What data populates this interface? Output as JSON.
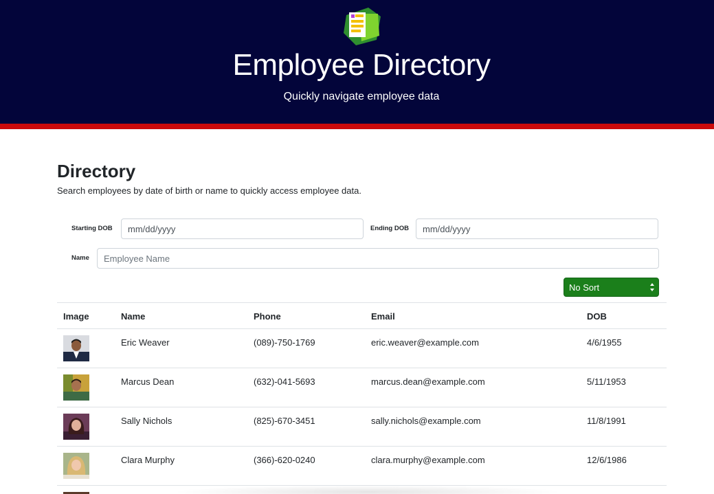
{
  "header": {
    "title": "Employee Directory",
    "subtitle": "Quickly navigate employee data",
    "logo_icon": "document-folder-icon"
  },
  "directory": {
    "title": "Directory",
    "description": "Search employees by date of birth or name to quickly access employee data."
  },
  "filters": {
    "start_dob_label": "Starting DOB",
    "start_dob_value": "mm/dd/yyyy",
    "end_dob_label": "Ending DOB",
    "end_dob_value": "mm/dd/yyyy",
    "name_label": "Name",
    "name_placeholder": "Employee Name"
  },
  "sort": {
    "selected": "No Sort"
  },
  "table": {
    "headers": {
      "image": "Image",
      "name": "Name",
      "phone": "Phone",
      "email": "Email",
      "dob": "DOB"
    },
    "rows": [
      {
        "name": "Eric Weaver",
        "phone": "(089)-750-1769",
        "email": "eric.weaver@example.com",
        "dob": "4/6/1955"
      },
      {
        "name": "Marcus Dean",
        "phone": "(632)-041-5693",
        "email": "marcus.dean@example.com",
        "dob": "5/11/1953"
      },
      {
        "name": "Sally Nichols",
        "phone": "(825)-670-3451",
        "email": "sally.nichols@example.com",
        "dob": "11/8/1991"
      },
      {
        "name": "Clara Murphy",
        "phone": "(366)-620-0240",
        "email": "clara.murphy@example.com",
        "dob": "12/6/1986"
      }
    ]
  },
  "colors": {
    "header_bg": "#03053a",
    "accent_stripe": "#cc0a0a",
    "sort_button": "#1b7f1b"
  }
}
